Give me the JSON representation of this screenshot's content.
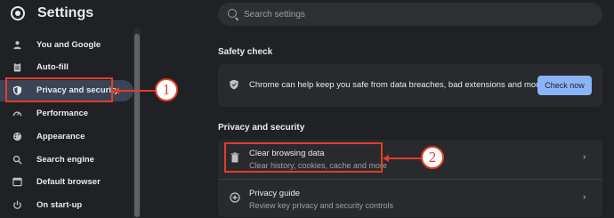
{
  "app": {
    "title": "Settings",
    "logo_icon": "chrome-logo-icon"
  },
  "search": {
    "placeholder": "Search settings",
    "value": ""
  },
  "sidebar": {
    "items": [
      {
        "label": "You and Google",
        "icon": "person-icon"
      },
      {
        "label": "Auto-fill",
        "icon": "clipboard-icon"
      },
      {
        "label": "Privacy and security",
        "icon": "shield-icon",
        "active": true
      },
      {
        "label": "Performance",
        "icon": "speedometer-icon"
      },
      {
        "label": "Appearance",
        "icon": "palette-icon"
      },
      {
        "label": "Search engine",
        "icon": "search-icon"
      },
      {
        "label": "Default browser",
        "icon": "browser-icon"
      },
      {
        "label": "On start-up",
        "icon": "power-icon"
      }
    ]
  },
  "safety_check": {
    "title": "Safety check",
    "text": "Chrome can help keep you safe from data breaches, bad extensions and more",
    "button": "Check now"
  },
  "privacy": {
    "title": "Privacy and security",
    "rows": [
      {
        "title": "Clear browsing data",
        "subtitle": "Clear history, cookies, cache and more",
        "icon": "trash-icon"
      },
      {
        "title": "Privacy guide",
        "subtitle": "Review key privacy and security controls",
        "icon": "compass-icon"
      }
    ]
  },
  "callouts": [
    {
      "number": "1"
    },
    {
      "number": "2"
    }
  ],
  "colors": {
    "accent": "#8ab4f8",
    "active_bg": "#394457",
    "callout": "#e23d28",
    "background": "#202124",
    "card": "#292a2d"
  }
}
